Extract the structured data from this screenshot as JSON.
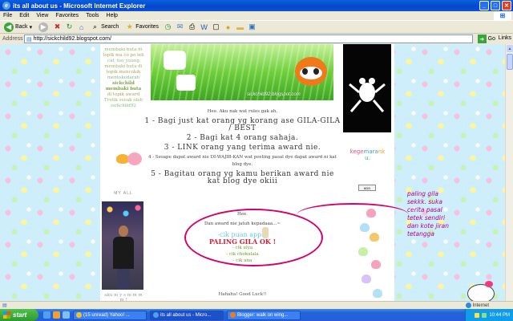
{
  "window": {
    "title": "its all about us - Microsoft Internet Explorer",
    "ie_icon": "ie-logo-icon",
    "controls": [
      "minimize",
      "maximize",
      "close"
    ]
  },
  "menu": {
    "items": [
      "File",
      "Edit",
      "View",
      "Favorites",
      "Tools",
      "Help"
    ]
  },
  "toolbar": {
    "back_label": "Back",
    "search_label": "Search",
    "favorites_label": "Favorites"
  },
  "address": {
    "label": "Address",
    "url": "http://sickchild92.blogspot.com/",
    "go_label": "Go",
    "links_label": "Links"
  },
  "left_sidebar": {
    "links": [
      {
        "text": "membaki buta di",
        "style": "g"
      },
      {
        "text": "topik ma co po leh",
        "style": "y"
      },
      {
        "text": "cat_too_young",
        "style": "gr"
      },
      {
        "text": "membaki buta di",
        "style": "g"
      },
      {
        "text": "topik mencokik",
        "style": "y"
      },
      {
        "text": "mentokedarah",
        "style": "gr"
      },
      {
        "text": "sickchild membaki buta",
        "style": "bold"
      },
      {
        "text": "di topik award",
        "style": "y"
      },
      {
        "text": "Trufik seeak oleh",
        "style": "g"
      },
      {
        "text": "sickchild92",
        "style": "gr"
      }
    ],
    "section_title": "MY ALL",
    "footer": "aku m y s m m m m !"
  },
  "post": {
    "banner_url": "sickchild92.blogspot.com",
    "lines": [
      {
        "text": "Hee. Aku nak wat rules gak ah.",
        "cls": "p"
      },
      {
        "text": "1 - Bagi just kat orang yg korang ase GILA-GILA / BEST",
        "cls": "p big"
      },
      {
        "text": "2 - Bagi kat 4 orang sahaja.",
        "cls": "p big"
      },
      {
        "text": "3 - LINK orang yang terima award nie.",
        "cls": "p big"
      },
      {
        "text": "4 - Sesape dapat award nie DI-WAJIB-KAN wat posting pasal dye dapat award ni kat blog dye.",
        "cls": "p big"
      },
      {
        "text": "5 - Bagitau orang yg kamu berikan award nie kat blog dye okiii",
        "cls": "p big"
      }
    ],
    "dedication": {
      "hee": "Hee.",
      "intro": "Dan award nie jatuh kepadaaa...~",
      "apple": "-cik puan apple",
      "paling": "PALING GILA OK !",
      "names": [
        "- cik ulya",
        "- cik chokulala",
        "- cik una"
      ]
    },
    "footer": "Hahaha! Good Luck!!"
  },
  "right_sidebar": {
    "title_parts": [
      "kege",
      "mara",
      "nk",
      "u."
    ],
    "add_label": "ADD"
  },
  "annotation": {
    "lines": [
      "paling gila",
      "sekkk. suka",
      "cerita pasal",
      "tetek sendiri",
      "dan kote jiran",
      "tetangga"
    ]
  },
  "statusbar": {
    "zone": "Internet"
  },
  "taskbar": {
    "start_label": "start",
    "tasks": [
      "(15 unread) Yahoo! ...",
      "its all about us - Micro...",
      "Blogger: walk on wing..."
    ],
    "clock": "10:44 PM"
  },
  "colors": {
    "accent": "#d4006a",
    "annotation": "#b0008c",
    "titlebar": "#0346c8"
  }
}
